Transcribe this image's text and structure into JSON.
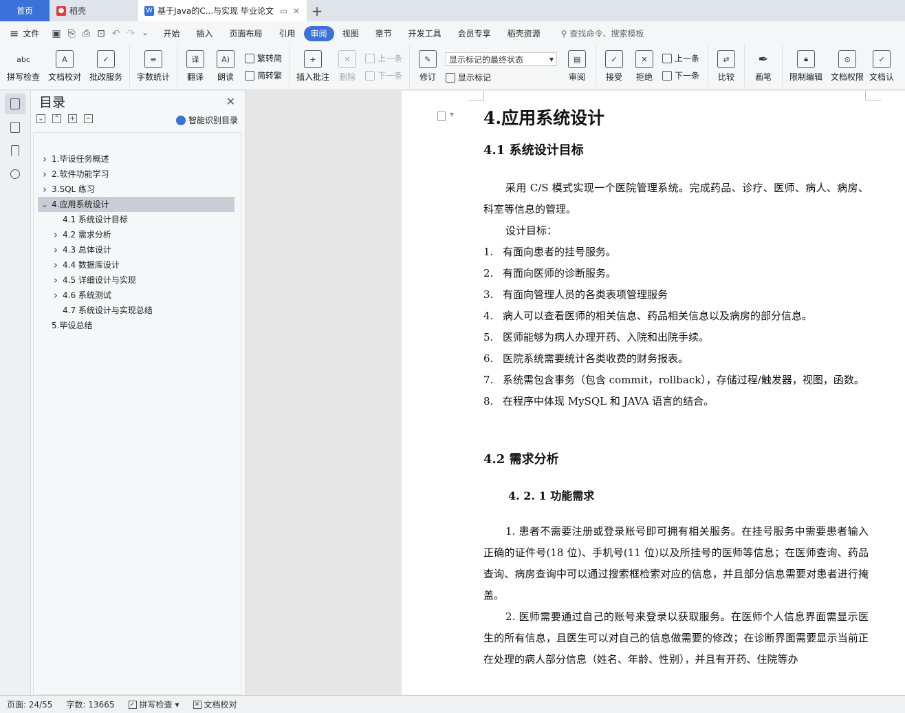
{
  "tabs": {
    "home": "首页",
    "docer": "稻壳",
    "doc": "基于Java的C...与实现 毕业论文",
    "add": "+"
  },
  "menu": {
    "file": "文件",
    "items": [
      "开始",
      "插入",
      "页面布局",
      "引用",
      "审阅",
      "视图",
      "章节",
      "开发工具",
      "会员专享",
      "稻壳资源"
    ],
    "active": "审阅",
    "search": "查找命令、搜索模板"
  },
  "ribbon": {
    "spell": "拼写检查",
    "proof": "文档校对",
    "review_service": "批改服务",
    "word_count": "字数统计",
    "translate": "翻译",
    "read_aloud": "朗读",
    "trad_to_simp": "繁转简",
    "simp_to_trad": "简转繁",
    "insert_comment": "插入批注",
    "delete": "删除",
    "prev_comment": "上一条",
    "next_comment": "下一条",
    "track": "修订",
    "markup_select": "显示标记的最终状态",
    "show_markup": "显示标记",
    "review": "审阅",
    "accept": "接受",
    "reject": "拒绝",
    "prev_change": "上一条",
    "next_change": "下一条",
    "compare": "比较",
    "pen": "画笔",
    "restrict": "限制编辑",
    "permission": "文档权限",
    "certify": "文档认"
  },
  "toc": {
    "title": "目录",
    "smart": "智能识别目录",
    "items": [
      {
        "label": "1.毕设任务概述",
        "level": 1,
        "expandable": true,
        "expanded": false
      },
      {
        "label": "2.软件功能学习",
        "level": 1,
        "expandable": true,
        "expanded": false
      },
      {
        "label": "3.SQL 练习",
        "level": 1,
        "expandable": true,
        "expanded": false
      },
      {
        "label": "4.应用系统设计",
        "level": 1,
        "expandable": true,
        "expanded": true,
        "active": true
      },
      {
        "label": "4.1 系统设计目标",
        "level": 2,
        "expandable": false
      },
      {
        "label": "4.2  需求分析",
        "level": 2,
        "expandable": true,
        "expanded": false
      },
      {
        "label": "4.3  总体设计",
        "level": 2,
        "expandable": true,
        "expanded": false
      },
      {
        "label": "4.4  数据库设计",
        "level": 2,
        "expandable": true,
        "expanded": false
      },
      {
        "label": "4.5  详细设计与实现",
        "level": 2,
        "expandable": true,
        "expanded": false
      },
      {
        "label": "4.6  系统测试",
        "level": 2,
        "expandable": true,
        "expanded": false
      },
      {
        "label": "4.7  系统设计与实现总结",
        "level": 2,
        "expandable": false
      },
      {
        "label": "5.毕设总结",
        "level": 1,
        "expandable": false
      }
    ]
  },
  "document": {
    "h1": "4.应用系统设计",
    "h2_1": "4.1 系统设计目标",
    "para1": "采用 C/S 模式实现一个医院管理系统。完成药品、诊疗、医师、病人、病房、科室等信息的管理。",
    "goal_label": "设计目标：",
    "goals": [
      {
        "num": "1.",
        "text": "有面向患者的挂号服务。"
      },
      {
        "num": "2.",
        "text": "有面向医师的诊断服务。"
      },
      {
        "num": "3.",
        "text": "有面向管理人员的各类表项管理服务"
      },
      {
        "num": "4.",
        "text": "病人可以查看医师的相关信息、药品相关信息以及病房的部分信息。"
      },
      {
        "num": "5.",
        "text": "医师能够为病人办理开药、入院和出院手续。"
      },
      {
        "num": "6.",
        "text": "医院系统需要统计各类收费的财务报表。"
      },
      {
        "num": "7.",
        "text": "系统需包含事务（包含 commit，rollback），存储过程/触发器，视图，函数。"
      },
      {
        "num": "8.",
        "text": "在程序中体现 MySQL 和 JAVA 语言的结合。"
      }
    ],
    "h2_2": "4.2  需求分析",
    "h3_1": "4. 2. 1  功能需求",
    "para2": "1. 患者不需要注册或登录账号即可拥有相关服务。在挂号服务中需要患者输入正确的证件号(18 位)、手机号(11 位)以及所挂号的医师等信息；在医师查询、药品查询、病房查询中可以通过搜索框检索对应的信息，并且部分信息需要对患者进行掩盖。",
    "para3": "2. 医师需要通过自己的账号来登录以获取服务。在医师个人信息界面需显示医生的所有信息，且医生可以对自己的信息做需要的修改；在诊断界面需要显示当前正在处理的病人部分信息（姓名、年龄、性别），并且有开药、住院等办"
  },
  "status": {
    "page": "页面: 24/55",
    "words": "字数: 13665",
    "spell": "拼写检查",
    "proof": "文档校对"
  }
}
